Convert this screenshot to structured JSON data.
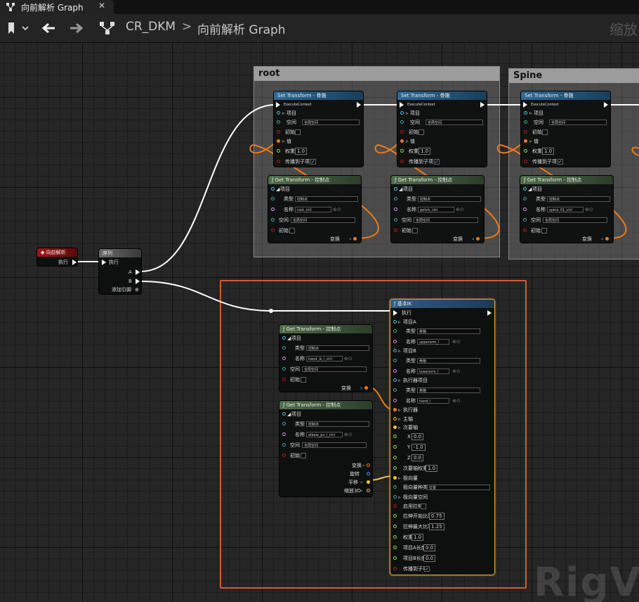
{
  "tab": {
    "title": "向前解析 Graph",
    "close": "✕"
  },
  "toolbar": {
    "asset": "CR_DKM",
    "separator": ">",
    "graph": "向前解析 Graph",
    "zoom": "缩放"
  },
  "comments": {
    "root": "root",
    "spine": "Spine"
  },
  "set_transform": {
    "title": "Set Transform - 骨骼",
    "execute": "ExecuteContext",
    "item": "项目",
    "space": "空间",
    "space_value": "全局空间",
    "initial": "初始",
    "value": "值",
    "weight": "权重",
    "weight_value": "1.0",
    "propagate": "传播到子项",
    "check": "✓"
  },
  "get_transform": {
    "title": "Get Transform - 控制点",
    "item": "项目",
    "type": "类型",
    "type_value": "控制点",
    "name": "名称",
    "space": "空间",
    "space_value": "全局空间",
    "initial": "初始",
    "transform": "变换",
    "rotation": "旋转",
    "translation": "平移",
    "scale": "缩放3D",
    "names": [
      "root_ctrl",
      "pelvis_ctrl",
      "spine_01_ctrl",
      "hand_ik_l_ctrl",
      "elbow_pv_l_ctrl"
    ]
  },
  "event": {
    "title": "向前解析",
    "exec": "执行"
  },
  "sequence": {
    "title": "序列",
    "exec": "执行",
    "a": "A",
    "b": "B",
    "add_pin": "添加引脚"
  },
  "basic_ik": {
    "title": "基本IK",
    "exec": "执行",
    "item_a": "项目A",
    "item_b": "项目B",
    "effector_item": "执行器项目",
    "type": "类型",
    "type_value": "骨骼",
    "name": "名称",
    "item_a_name": "upperarm_l",
    "item_b_name": "lowerarm_l",
    "effector_name": "hand_l",
    "effector": "执行器",
    "primary_axis": "主轴",
    "secondary_axis": "次要轴",
    "x": "X",
    "y": "Y",
    "z": "Z",
    "x_value": "0.0",
    "y_value": "-1.0",
    "z_value": "0.0",
    "secondary_weight": "次要轴权重",
    "secondary_weight_value": "1.0",
    "pole_vector": "极向量",
    "pole_vector_kind": "极向量种类",
    "pole_vector_kind_value": "位置",
    "pole_vector_space": "极向量空间",
    "enable_stretch": "启用拉伸",
    "stretch_start": "拉伸开始比率",
    "stretch_start_value": "0.75",
    "stretch_max": "拉伸最大比率",
    "stretch_max_value": "1.25",
    "weight": "权重",
    "weight_value": "1.0",
    "bone_a_length": "项目A长度",
    "bone_a_value": "0.0",
    "bone_b_length": "项目B长度",
    "bone_b_value": "0.0",
    "propagate": "传播到子项",
    "check": "✓"
  },
  "watermark": "RigVM",
  "colors": {
    "exec": "#ffffff",
    "transform": "#f07a17",
    "vector": "#f5c242",
    "key": "#4fc1e0",
    "name": "#c88ef5",
    "bool": "#b01a1a",
    "float": "#84e04a",
    "space": "#3aa7a0",
    "comment_box": "#d05a37"
  }
}
